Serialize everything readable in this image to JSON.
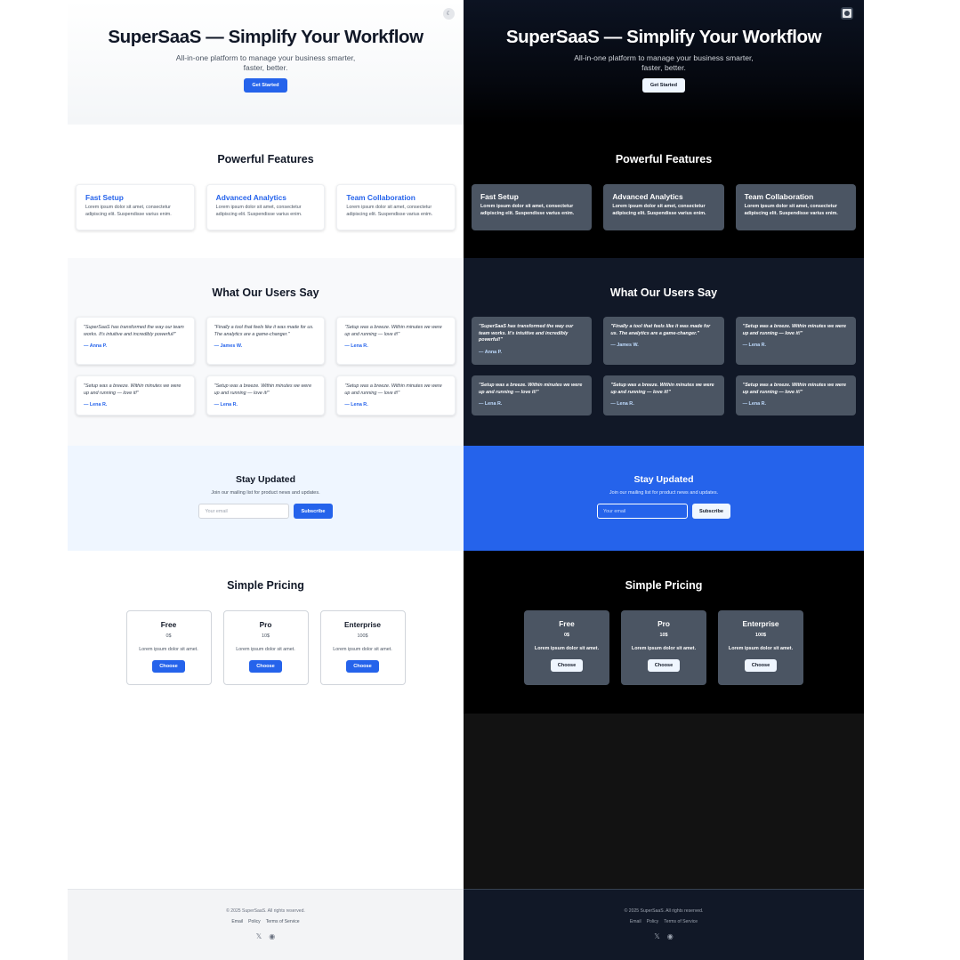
{
  "hero": {
    "title": "SuperSaaS — Simplify Your Workflow",
    "subtitle": "All-in-one platform to manage your business smarter, faster, better.",
    "cta_label": "Get Started",
    "toggle_icon_light": "moon-icon",
    "toggle_icon_dark": "sun-icon"
  },
  "features": {
    "title": "Powerful Features",
    "items": [
      {
        "title": "Fast Setup",
        "text": "Lorem ipsum dolor sit amet, consectetur adipiscing elit. Suspendisse varius enim."
      },
      {
        "title": "Advanced Analytics",
        "text": "Lorem ipsum dolor sit amet, consectetur adipiscing elit. Suspendisse varius enim."
      },
      {
        "title": "Team Collaboration",
        "text": "Lorem ipsum dolor sit amet, consectetur adipiscing elit. Suspendisse varius enim."
      }
    ]
  },
  "testimonials": {
    "title": "What Our Users Say",
    "items": [
      {
        "quote": "\"SuperSaaS has transformed the way our team works. It's intuitive and incredibly powerful!\"",
        "author": "— Anna P."
      },
      {
        "quote": "\"Finally a tool that feels like it was made for us. The analytics are a game-changer.\"",
        "author": "— James W."
      },
      {
        "quote": "\"Setup was a breeze. Within minutes we were up and running — love it!\"",
        "author": "— Lena R."
      },
      {
        "quote": "\"Setup was a breeze. Within minutes we were up and running — love it!\"",
        "author": "— Lena R."
      },
      {
        "quote": "\"Setup was a breeze. Within minutes we were up and running — love it!\"",
        "author": "— Lena R."
      },
      {
        "quote": "\"Setup was a breeze. Within minutes we were up and running — love it!\"",
        "author": "— Lena R."
      }
    ]
  },
  "newsletter": {
    "title": "Stay Updated",
    "text": "Join our mailing list for product news and updates.",
    "placeholder": "Your email",
    "button_label": "Subscribe"
  },
  "pricing": {
    "title": "Simple Pricing",
    "plans": [
      {
        "name": "Free",
        "price": "0$",
        "desc": "Lorem ipsum dolor sit amet.",
        "button": "Choose"
      },
      {
        "name": "Pro",
        "price": "10$",
        "desc": "Lorem ipsum dolor sit amet.",
        "button": "Choose"
      },
      {
        "name": "Enterprise",
        "price": "100$",
        "desc": "Lorem ipsum dolor sit amet.",
        "button": "Choose"
      }
    ]
  },
  "footer": {
    "copyright": "© 2025 SuperSaaS. All rights reserved.",
    "links": [
      "Email",
      "Policy",
      "Terms of Service"
    ],
    "social_icons": [
      "x-icon",
      "github-icon"
    ]
  },
  "colors": {
    "accent": "#2563eb",
    "dark_card": "#4b5563",
    "dark_section": "#111827",
    "newsletter_light": "#eff6ff"
  }
}
